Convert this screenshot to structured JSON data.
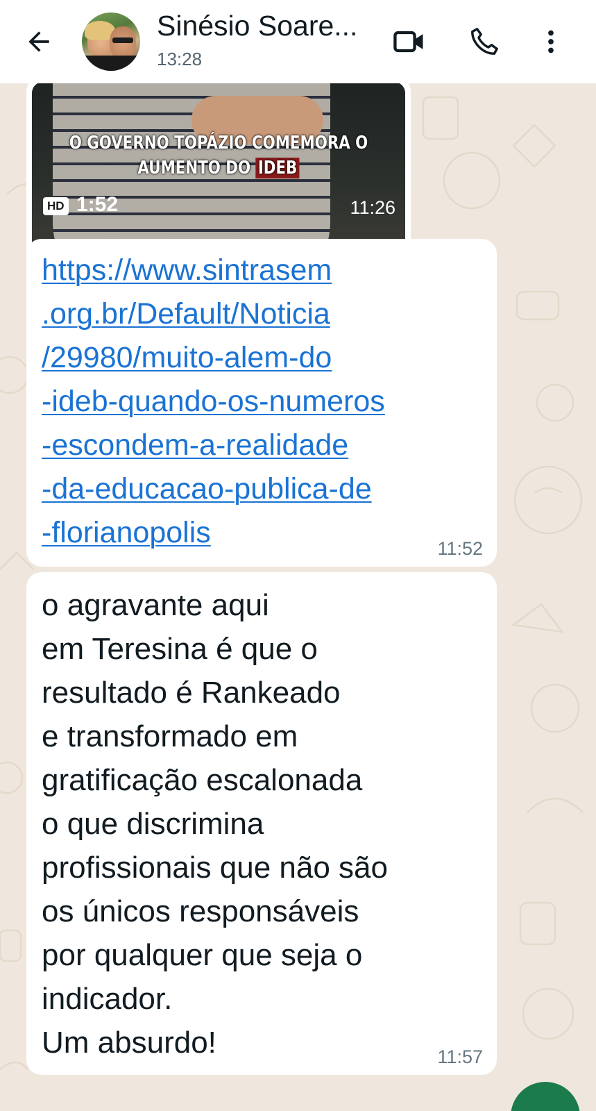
{
  "header": {
    "contact_name": "Sinésio Soare...",
    "status": "13:28",
    "icons": [
      "back-arrow-icon",
      "video-call-icon",
      "phone-call-icon",
      "more-options-icon"
    ]
  },
  "messages": {
    "video": {
      "caption_line1": "O GOVERNO TOPÁZIO COMEMORA O",
      "caption_line2_prefix": "AUMENTO DO",
      "caption_highlight": "IDEB",
      "hd_label": "HD",
      "duration": "1:52",
      "time": "11:26"
    },
    "link": {
      "text": "https://www.sintrasem\n.org.br/Default/Noticia\n/29980/muito-alem-do\n-ideb-quando-os-numeros\n-escondem-a-realidade\n-da-educacao-publica-de\n-florianopolis",
      "time": "11:52"
    },
    "text": {
      "body": "o agravante aqui\nem Teresina é que o\nresultado é Rankeado\ne transformado em\ngratificação escalonada\no que discrimina\nprofissionais que não são\nos únicos responsáveis\npor qualquer que seja o\nindicador.\nUm absurdo!",
      "time": "11:57"
    }
  },
  "colors": {
    "header_bg": "#ffffff",
    "chat_bg": "#efe7dd",
    "link": "#1a73d4",
    "fab": "#1b7b4a"
  }
}
